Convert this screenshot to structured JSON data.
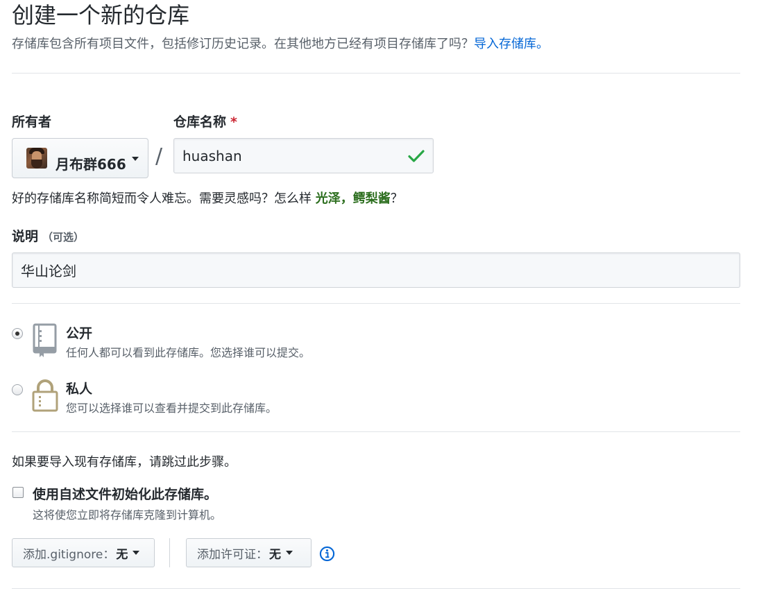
{
  "header": {
    "title": "创建一个新的仓库",
    "subtitle": "存储库包含所有项目文件，包括修订历史记录。在其他地方已经有项目存储库了吗？",
    "import_link": "导入存储库。"
  },
  "owner": {
    "label": "所有者",
    "name": "月布群666",
    "avatar_icon": "avatar"
  },
  "repo_name": {
    "label": "仓库名称",
    "required_mark": "*",
    "value": "huashan",
    "separator": "/",
    "valid_icon": "check-icon"
  },
  "hint": {
    "prefix": "好的存储库名称简短而令人难忘。需要灵感吗？怎么样 ",
    "suggestion": "光泽，鳄梨酱",
    "suffix": "？"
  },
  "description": {
    "label": "说明",
    "optional": "（可选）",
    "value": "华山论剑"
  },
  "visibility": {
    "public": {
      "title": "公开",
      "desc": "任何人都可以看到此存储库。您选择谁可以提交。",
      "icon": "repo-book-icon",
      "selected": true
    },
    "private": {
      "title": "私人",
      "desc": "您可以选择谁可以查看并提交到此存储库。",
      "icon": "lock-icon",
      "selected": false
    }
  },
  "init": {
    "skip_note": "如果要导入现有存储库，请跳过此步骤。",
    "readme_title": "使用自述文件初始化此存储库。",
    "readme_desc": "这将使您立即将存储库克隆到计算机。",
    "readme_checked": false
  },
  "gitignore": {
    "label": "添加.gitignore：",
    "value": "无"
  },
  "license": {
    "label": "添加许可证：",
    "value": "无",
    "info_icon": "info-icon"
  },
  "colors": {
    "link": "#0366d6",
    "success": "#28a745",
    "required": "#cb2431",
    "private_icon": "#b0a27a"
  }
}
